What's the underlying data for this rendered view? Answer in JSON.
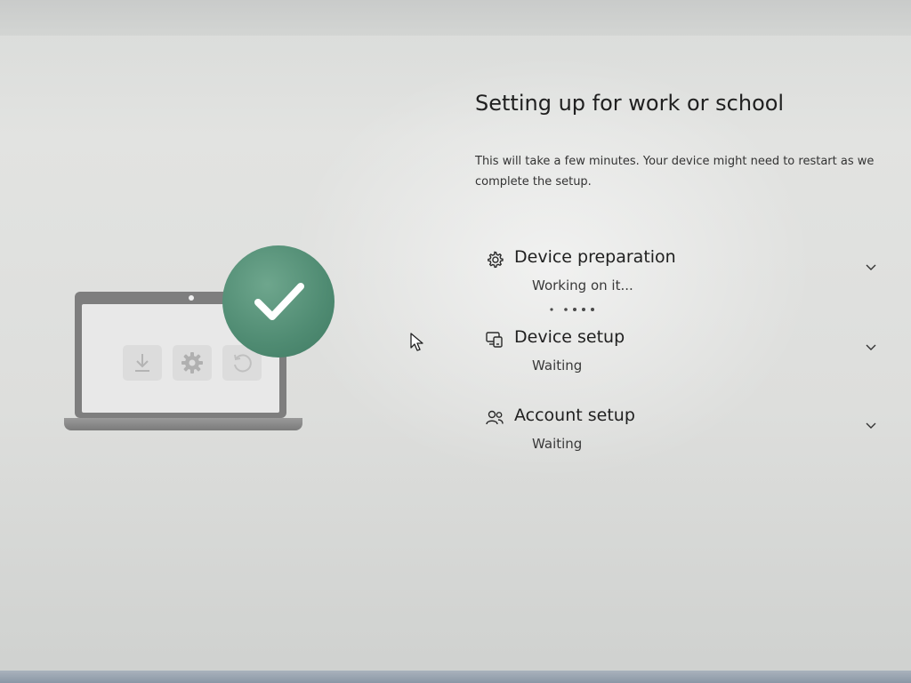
{
  "page": {
    "title": "Setting up for work or school",
    "subtitle": "This will take a few minutes. Your device might need to restart as we complete the setup."
  },
  "steps": [
    {
      "title": "Device preparation",
      "status": "Working on it...",
      "icon": "gear-icon",
      "state": "in-progress"
    },
    {
      "title": "Device setup",
      "status": "Waiting",
      "icon": "device-setup-icon",
      "state": "waiting"
    },
    {
      "title": "Account setup",
      "status": "Waiting",
      "icon": "people-icon",
      "state": "waiting"
    }
  ],
  "illustration": {
    "icons": [
      "download-icon",
      "gear-icon",
      "restart-icon",
      "checkmark-icon"
    ],
    "badge_color": "#4f8b72"
  },
  "colors": {
    "background": "#e0e1df",
    "text": "#202020",
    "accent": "#4f8b72"
  }
}
